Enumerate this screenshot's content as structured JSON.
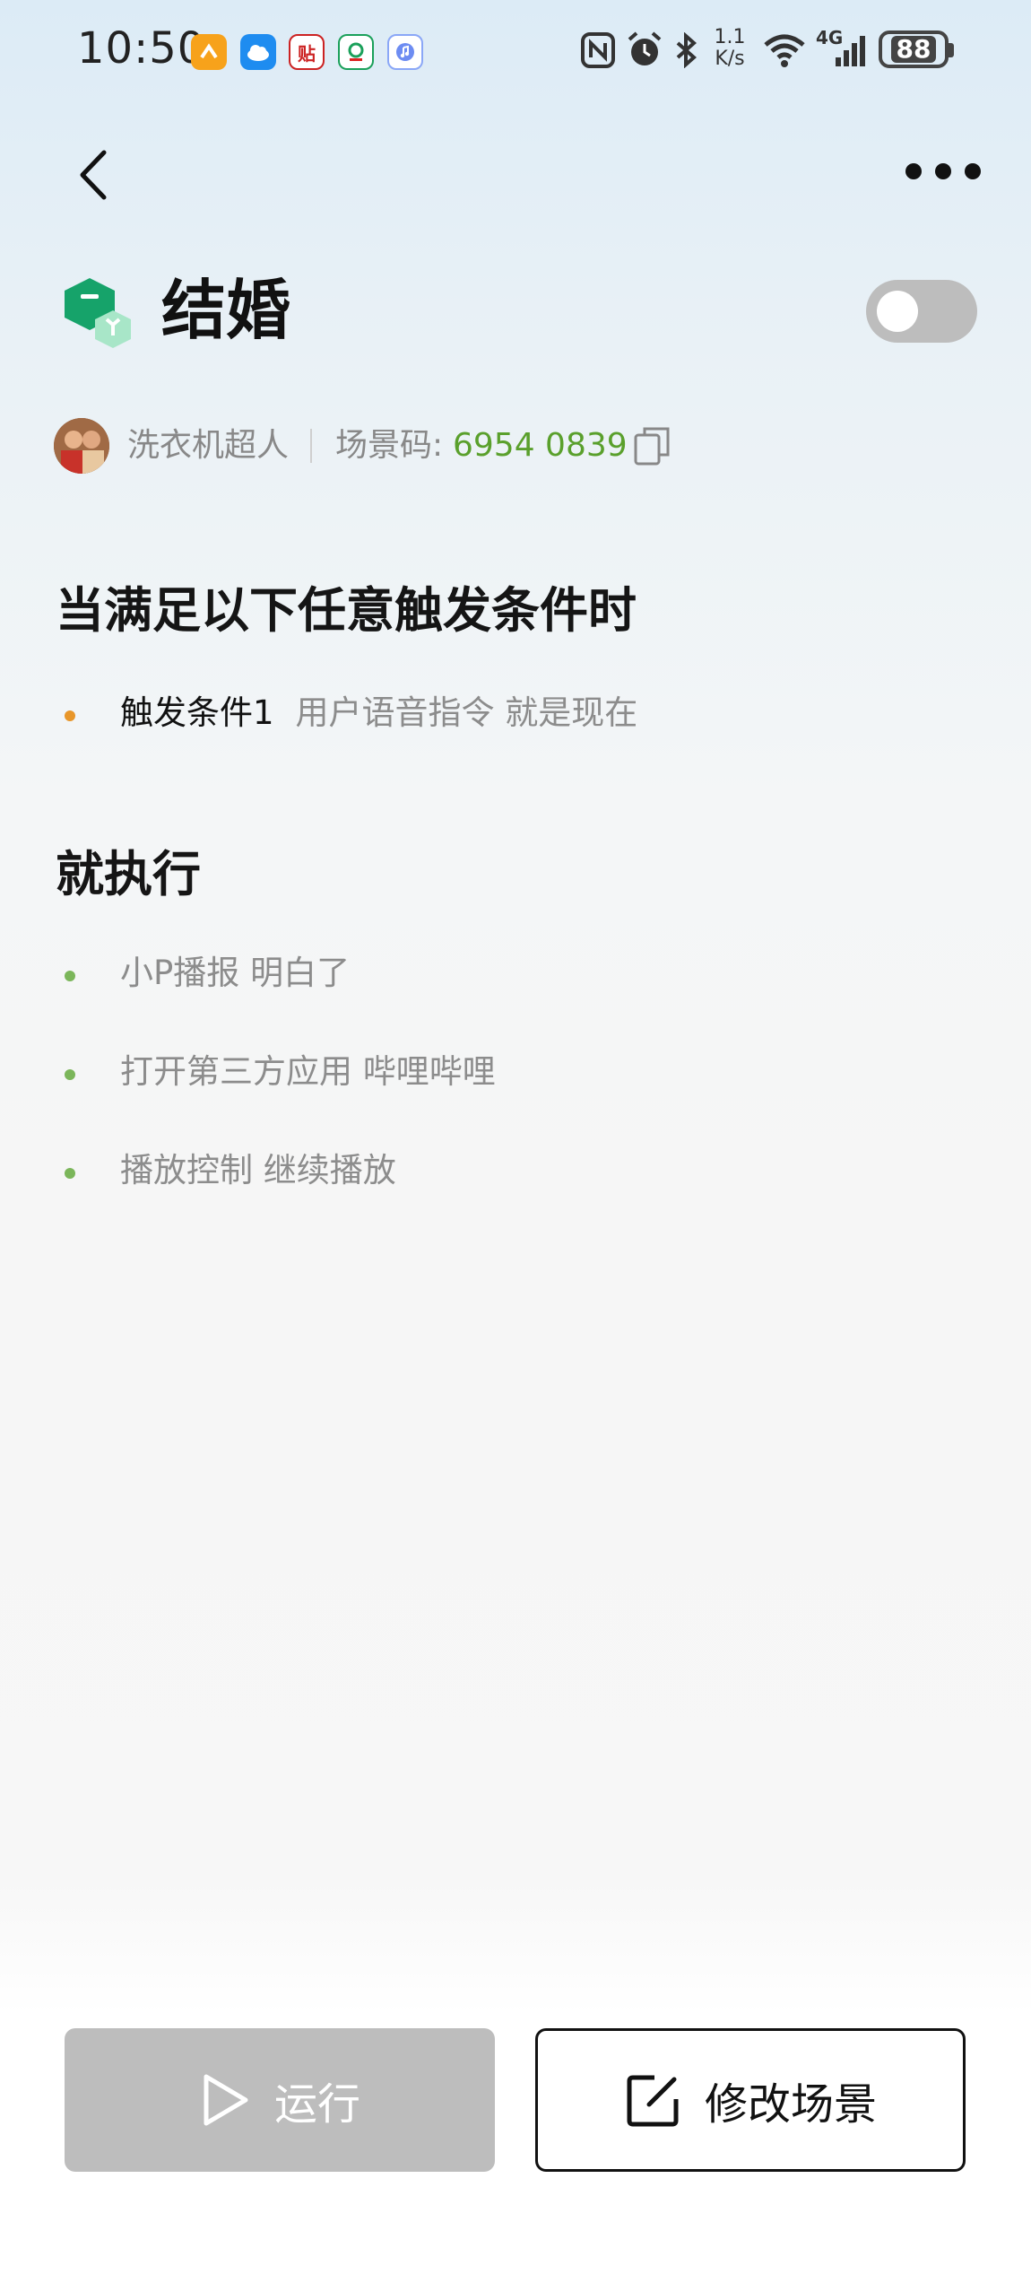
{
  "status_bar": {
    "time": "10:50",
    "network_speed_top": "1.1",
    "network_speed_bottom": "K/s",
    "network_type": "4G",
    "battery": "88",
    "app_icons": [
      "taobao-app-icon",
      "cloud-app-icon",
      "tieba-app-icon",
      "china-mobile-app-icon",
      "music-app-icon"
    ],
    "system_icons": [
      "nfc-icon",
      "alarm-icon",
      "bluetooth-icon",
      "wifi-icon",
      "signal-icon",
      "battery-icon"
    ]
  },
  "header": {
    "back_icon": "back-arrow-icon",
    "more_icon": "more-dots-icon"
  },
  "scene": {
    "title": "结婚",
    "enabled": false,
    "author": "洗衣机超人",
    "code_label": "场景码:",
    "code_value": "6954 0839"
  },
  "triggers": {
    "heading": "当满足以下任意触发条件时",
    "items": [
      {
        "label": "触发条件1",
        "description": "用户语音指令 就是现在"
      }
    ]
  },
  "actions": {
    "heading": "就执行",
    "items": [
      {
        "text": "小P播报 明白了"
      },
      {
        "text": "打开第三方应用 哔哩哔哩"
      },
      {
        "text": "播放控制 继续播放"
      }
    ]
  },
  "buttons": {
    "run_label": "运行",
    "edit_label": "修改场景"
  },
  "colors": {
    "accent_green": "#5aa02c",
    "trigger_bullet": "#e8962a",
    "action_bullet": "#7bb65a",
    "disabled_gray": "#bdbdbd"
  }
}
